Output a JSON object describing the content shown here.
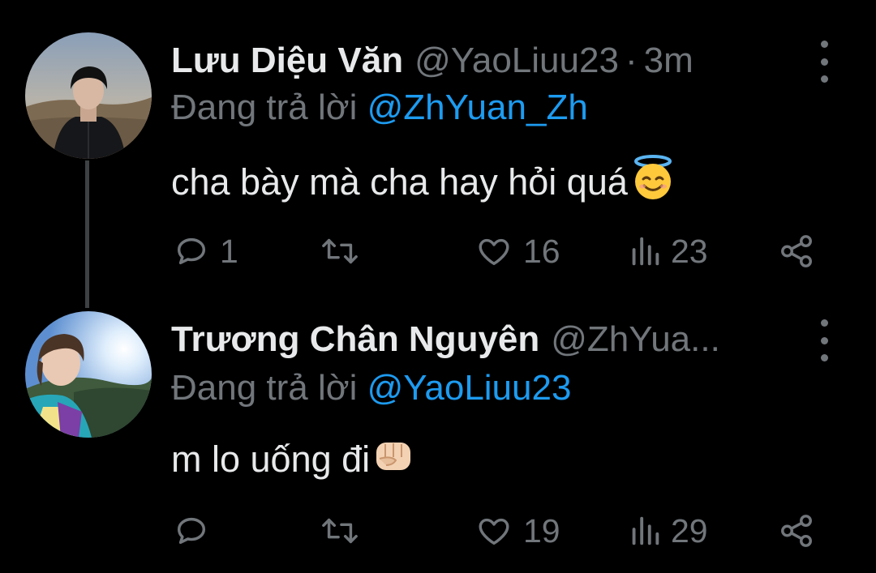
{
  "tweets": [
    {
      "name": "Lưu Diệu Văn",
      "handle": "@YaoLiuu23",
      "separator": "·",
      "time": "3m",
      "reply_prefix": "Đang trả lời",
      "reply_to": "@ZhYuan_Zh",
      "text": "cha bày mà cha hay hỏi quá",
      "emoji": "smiling-face-with-halo",
      "replies": "1",
      "retweets": "",
      "likes": "16",
      "views": "23"
    },
    {
      "name": "Trương Chân Nguyên",
      "handle": "@ZhYua...",
      "separator": "",
      "time": "",
      "reply_prefix": "Đang trả lời",
      "reply_to": "@YaoLiuu23",
      "text": "m lo uống đi",
      "emoji": "oncoming-fist",
      "replies": "",
      "retweets": "",
      "likes": "19",
      "views": "29"
    }
  ],
  "colors": {
    "background": "#000000",
    "primary_text": "#e7e9ea",
    "secondary_text": "#71767b",
    "link": "#1d9bf0",
    "thread_line": "#3e4144"
  },
  "icons": [
    "reply-icon",
    "retweet-icon",
    "like-icon",
    "views-icon",
    "share-icon",
    "more-icon"
  ]
}
